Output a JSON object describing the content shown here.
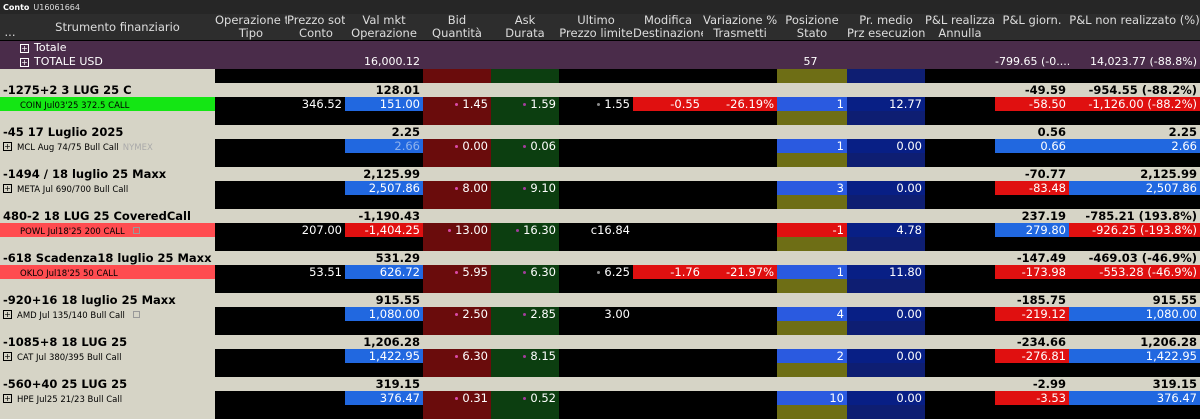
{
  "account": {
    "label": "Conto",
    "id": "U16061664"
  },
  "header": {
    "row1": [
      "...",
      "Strumento finanziario",
      "Operazione t",
      "Prezzo sott",
      "Val mkt",
      "Bid",
      "Ask",
      "Ultimo",
      "Modifica",
      "Variazione %",
      "Posizione",
      "Pr. medio",
      "P&L realizza",
      "P&L giorn.",
      "P&L non realizzato (%)"
    ],
    "row2": [
      "Tipo",
      "Conto",
      "Operazione",
      "Quantità",
      "Durata",
      "Prezzo limite",
      "Destinazione",
      "Trasmetti",
      "Stato",
      "Prz esecuzione",
      "Annulla"
    ]
  },
  "totals": {
    "totale_label": "Totale",
    "usd_label": "TOTALE   USD",
    "val_mkt": "16,000.12",
    "posizione": "57",
    "pl_giorn": "-799.65 (-0....",
    "pl_non_real": "14,023.77 (-88.8%)"
  },
  "colors": {
    "blue": "#2168e0",
    "red": "#e01010",
    "green": "#14e614",
    "group_bg": "#d6d4c6",
    "totals_bg": "#4a2c4a"
  },
  "groups": [
    {
      "name": "-1275+2 3 LUG 25 C",
      "val_mkt": "128.01",
      "pl_giorn": "-49.59",
      "pl_non_real": "-954.55 (-88.2%)",
      "instrument": {
        "name": "COIN Jul03'25 372.5 CALL",
        "exchange": "",
        "style": "green",
        "prezzo_sott": "346.52",
        "val_mkt": "151.00",
        "bid": "1.45",
        "ask": "1.59",
        "ultimo": "1.55",
        "modifica": "-0.55",
        "variazione": "-26.19%",
        "posizione": "1",
        "pr_medio": "12.77",
        "pl_giorn": "-58.50",
        "pl_non_real": "-1,126.00 (-88.2%)"
      }
    },
    {
      "name": "-45 17 Luglio 2025",
      "val_mkt": "2.25",
      "pl_giorn": "0.56",
      "pl_non_real": "2.25",
      "instrument": {
        "name": "MCL Aug 74/75 Bull Call",
        "exchange": "NYMEX",
        "style": "plain",
        "prezzo_sott": "",
        "val_mkt": "2.66",
        "bid": "0.00",
        "ask": "0.06",
        "ultimo": "",
        "modifica": "",
        "variazione": "",
        "posizione": "1",
        "pr_medio": "0.00",
        "pl_giorn": "0.66",
        "pl_non_real": "2.66"
      }
    },
    {
      "name": "-1494 / 18 luglio 25 Maxx",
      "val_mkt": "2,125.99",
      "pl_giorn": "-70.77",
      "pl_non_real": "2,125.99",
      "instrument": {
        "name": "META Jul 690/700 Bull Call",
        "exchange": "",
        "style": "plain",
        "prezzo_sott": "",
        "val_mkt": "2,507.86",
        "bid": "8.00",
        "ask": "9.10",
        "ultimo": "",
        "modifica": "",
        "variazione": "",
        "posizione": "3",
        "pr_medio": "0.00",
        "pl_giorn": "-83.48",
        "pl_non_real": "2,507.86"
      }
    },
    {
      "name": "480-2 18 LUG 25 CoveredCall",
      "val_mkt": "-1,190.43",
      "pl_giorn": "237.19",
      "pl_non_real": "-785.21 (193.8%)",
      "instrument": {
        "name": "POWL Jul18'25 200 CALL",
        "exchange": "",
        "style": "pink",
        "prezzo_sott": "207.00",
        "val_mkt": "-1,404.25",
        "bid": "13.00",
        "ask": "16.30",
        "ultimo": "c16.84",
        "modifica": "",
        "variazione": "",
        "posizione": "-1",
        "pr_medio": "4.78",
        "pl_giorn": "279.80",
        "pl_non_real": "-926.25 (-193.8%)"
      }
    },
    {
      "name": "-618 Scadenza18 luglio 25 Maxx",
      "val_mkt": "531.29",
      "pl_giorn": "-147.49",
      "pl_non_real": "-469.03 (-46.9%)",
      "instrument": {
        "name": "OKLO Jul18'25 50 CALL",
        "exchange": "",
        "style": "pink",
        "prezzo_sott": "53.51",
        "val_mkt": "626.72",
        "bid": "5.95",
        "ask": "6.30",
        "ultimo": "6.25",
        "modifica": "-1.76",
        "variazione": "-21.97%",
        "posizione": "1",
        "pr_medio": "11.80",
        "pl_giorn": "-173.98",
        "pl_non_real": "-553.28 (-46.9%)"
      }
    },
    {
      "name": "-920+16 18 luglio 25 Maxx",
      "val_mkt": "915.55",
      "pl_giorn": "-185.75",
      "pl_non_real": "915.55",
      "instrument": {
        "name": "AMD Jul 135/140 Bull Call",
        "exchange": "",
        "style": "plain",
        "prezzo_sott": "",
        "val_mkt": "1,080.00",
        "bid": "2.50",
        "ask": "2.85",
        "ultimo": "3.00",
        "modifica": "",
        "variazione": "",
        "posizione": "4",
        "pr_medio": "0.00",
        "pl_giorn": "-219.12",
        "pl_non_real": "1,080.00"
      }
    },
    {
      "name": "-1085+8 18 LUG 25",
      "val_mkt": "1,206.28",
      "pl_giorn": "-234.66",
      "pl_non_real": "1,206.28",
      "instrument": {
        "name": "CAT Jul 380/395 Bull Call",
        "exchange": "",
        "style": "plain",
        "prezzo_sott": "",
        "val_mkt": "1,422.95",
        "bid": "6.30",
        "ask": "8.15",
        "ultimo": "",
        "modifica": "",
        "variazione": "",
        "posizione": "2",
        "pr_medio": "0.00",
        "pl_giorn": "-276.81",
        "pl_non_real": "1,422.95"
      }
    },
    {
      "name": "-560+40 25 LUG 25",
      "val_mkt": "319.15",
      "pl_giorn": "-2.99",
      "pl_non_real": "319.15",
      "instrument": {
        "name": "HPE Jul25 21/23 Bull Call",
        "exchange": "",
        "style": "plain",
        "prezzo_sott": "",
        "val_mkt": "376.47",
        "bid": "0.31",
        "ask": "0.52",
        "ultimo": "",
        "modifica": "",
        "variazione": "",
        "posizione": "10",
        "pr_medio": "0.00",
        "pl_giorn": "-3.53",
        "pl_non_real": "376.47"
      }
    }
  ]
}
